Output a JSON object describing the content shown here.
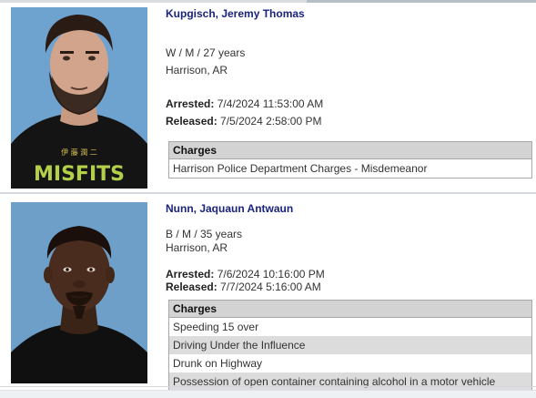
{
  "inmates": [
    {
      "name": "Kupgisch, Jeremy Thomas",
      "demographics": "W / M / 27 years",
      "location": "Harrison, AR",
      "arrested_label": "Arrested:",
      "arrested": "7/4/2024 11:53:00 AM",
      "released_label": "Released:",
      "released": "7/5/2024 2:58:00 PM",
      "charges_header": "Charges",
      "charges": [
        "Harrison Police Department Charges - Misdemeanor"
      ],
      "shirt_text": "MISFITS"
    },
    {
      "name": "Nunn, Jaquaun Antwaun",
      "demographics": "B / M / 35 years",
      "location": "Harrison, AR",
      "arrested_label": "Arrested:",
      "arrested": "7/6/2024 10:16:00 PM",
      "released_label": "Released:",
      "released": "7/7/2024 5:16:00 AM",
      "charges_header": "Charges",
      "charges": [
        "Speeding 15 over",
        "Driving Under the Influence",
        "Drunk on Highway",
        "Possession of open container containing alcohol in a motor vehicle"
      ]
    }
  ],
  "colors": {
    "name_color": "#1a237e",
    "photo_background": "#6fa3cf",
    "charges_header_bg": "#d3d3d3",
    "charges_alt_row_bg": "#dcdcdc"
  }
}
